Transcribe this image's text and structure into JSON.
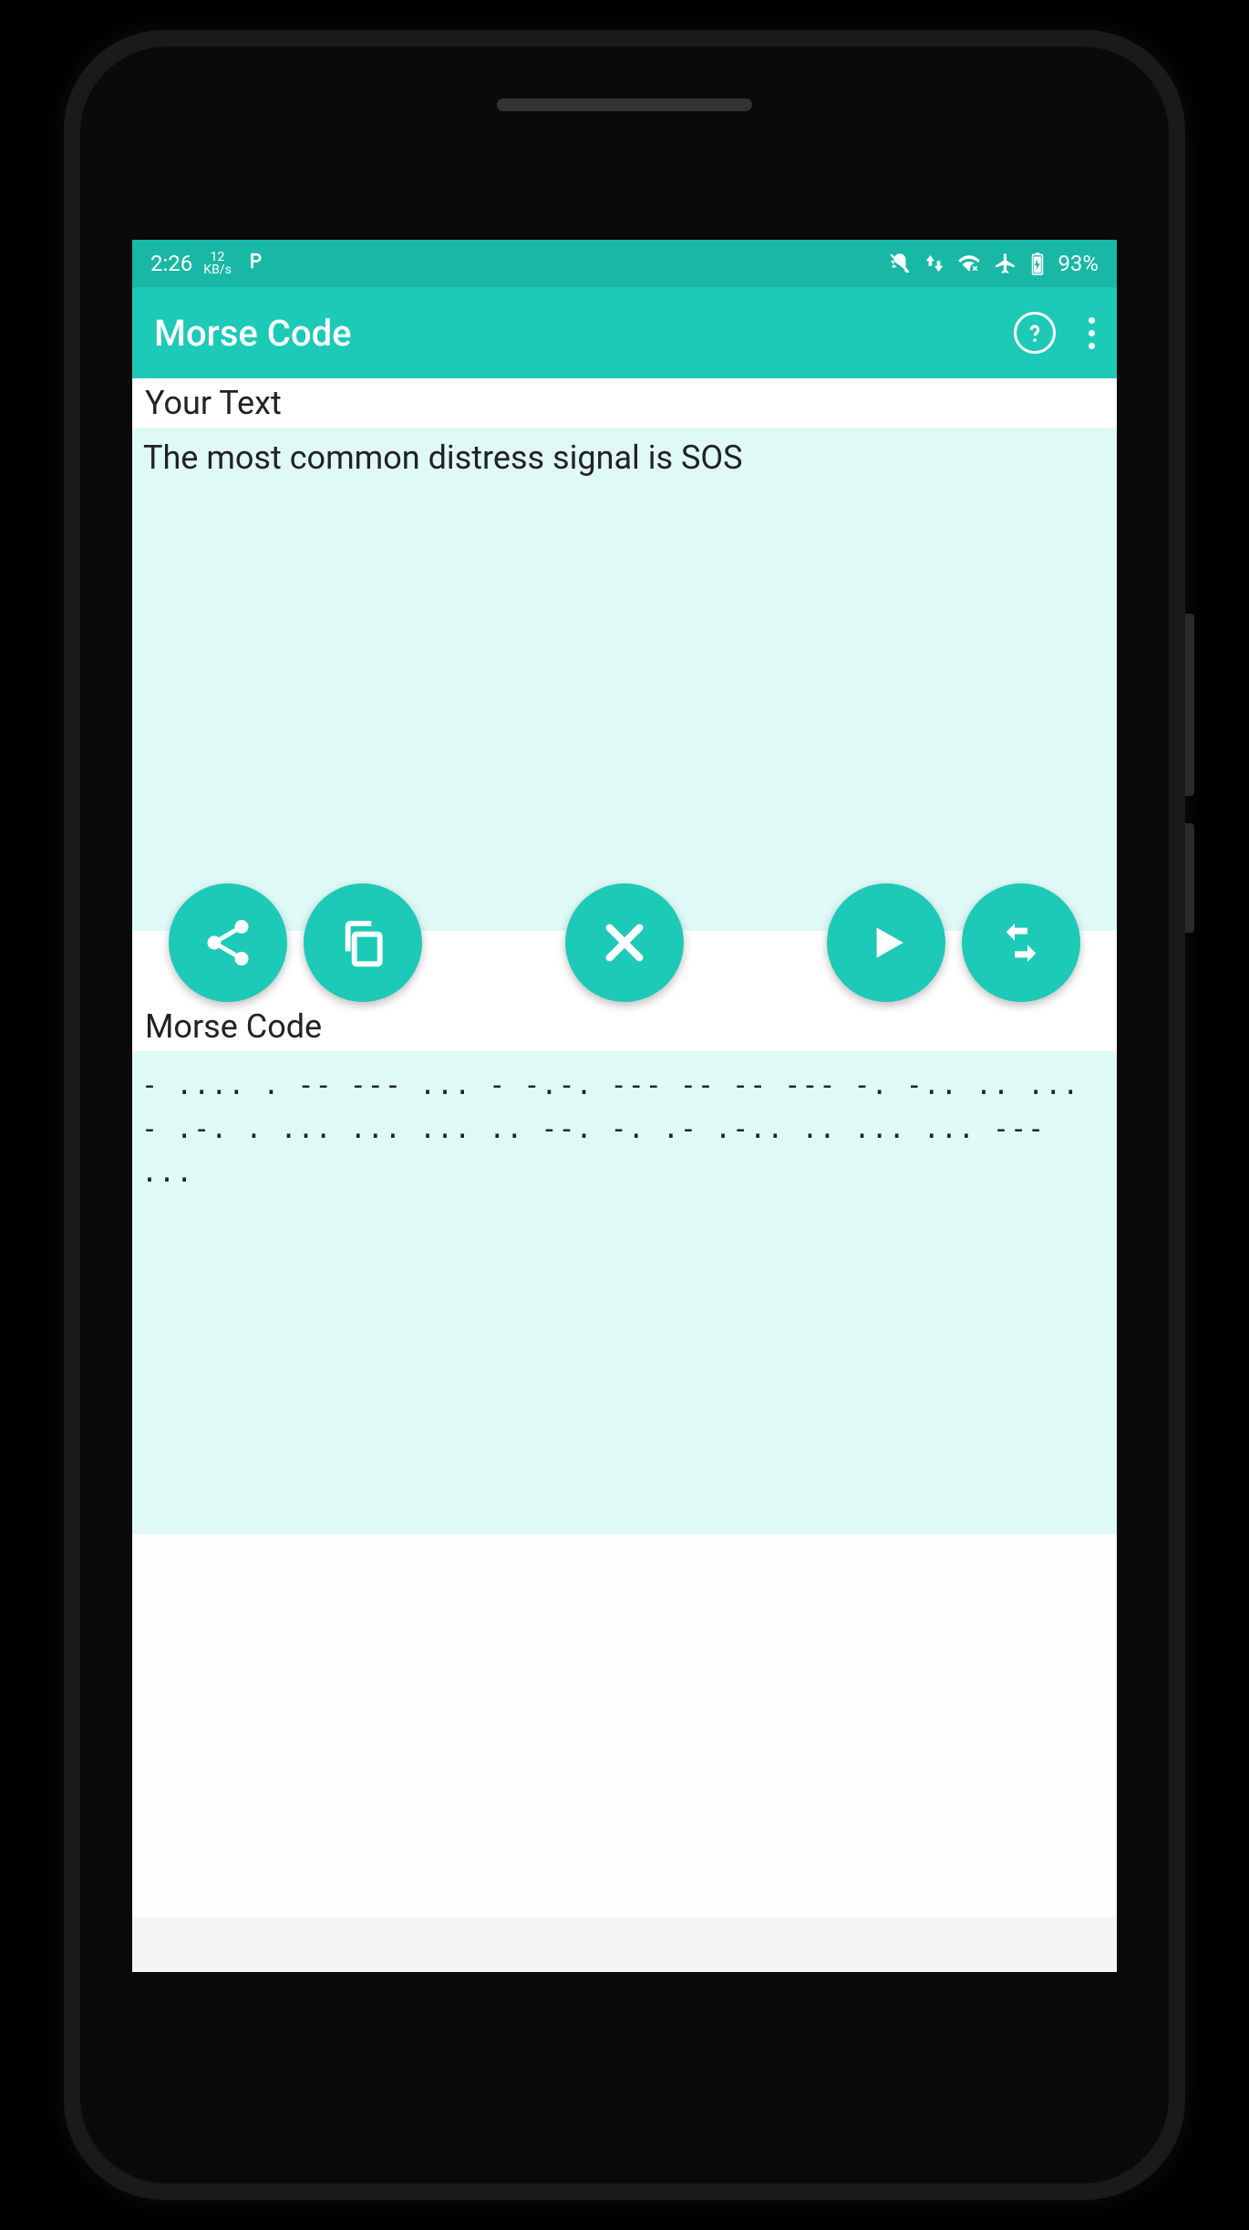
{
  "status_bar": {
    "time": "2:26",
    "speed_value": "12",
    "speed_unit": "KB/s",
    "battery_pct": "93%"
  },
  "app_bar": {
    "title": "Morse Code"
  },
  "input": {
    "label": "Your Text",
    "value": "The most common distress signal is SOS"
  },
  "output": {
    "label": "Morse Code",
    "value": "- .... .   -- --- ... -   -.-. --- -- -- --- -.   -.. .. ... - .-. . ... ...   ... .. --. -. .- .-..   .. ...   ... --- ..."
  },
  "colors": {
    "accent": "#1dc9b7",
    "accent_dark": "#18b8a5",
    "panel_bg": "#dff9f6"
  }
}
